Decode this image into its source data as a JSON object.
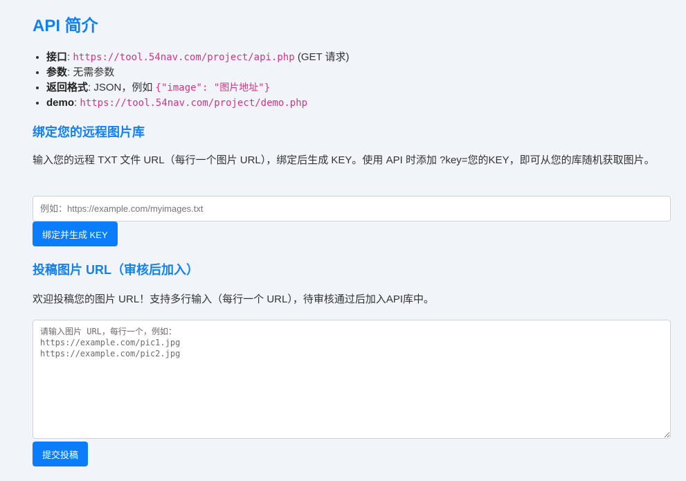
{
  "header": {
    "title": "API 简介"
  },
  "info": {
    "items": [
      {
        "label": "接口",
        "sep": ": ",
        "code": "https://tool.54nav.com/project/api.php",
        "suffix": " (GET 请求)"
      },
      {
        "label": "参数",
        "sep": ": ",
        "text": "无需参数"
      },
      {
        "label": "返回格式",
        "sep": ": ",
        "text": "JSON，例如 ",
        "code": "{\"image\": \"图片地址\"}"
      },
      {
        "label": "demo",
        "sep": ": ",
        "code": "https://tool.54nav.com/project/demo.php"
      }
    ]
  },
  "bind": {
    "heading": "绑定您的远程图片库",
    "description": "输入您的远程 TXT 文件 URL（每行一个图片 URL），绑定后生成 KEY。使用 API 时添加 ?key=您的KEY，即可从您的库随机获取图片。",
    "input_placeholder": "例如：https://example.com/myimages.txt",
    "input_value": "",
    "button_label": "绑定并生成 KEY"
  },
  "submit": {
    "heading": "投稿图片 URL（审核后加入）",
    "description": "欢迎投稿您的图片 URL！支持多行输入（每行一个 URL），待审核通过后加入API库中。",
    "textarea_placeholder": "请输入图片 URL，每行一个，例如：\nhttps://example.com/pic1.jpg\nhttps://example.com/pic2.jpg",
    "textarea_value": "",
    "button_label": "提交投稿"
  },
  "colors": {
    "accent": "#1181f2",
    "button": "#0b7dfa",
    "code": "#d63384",
    "background": "#f1f4f8"
  }
}
